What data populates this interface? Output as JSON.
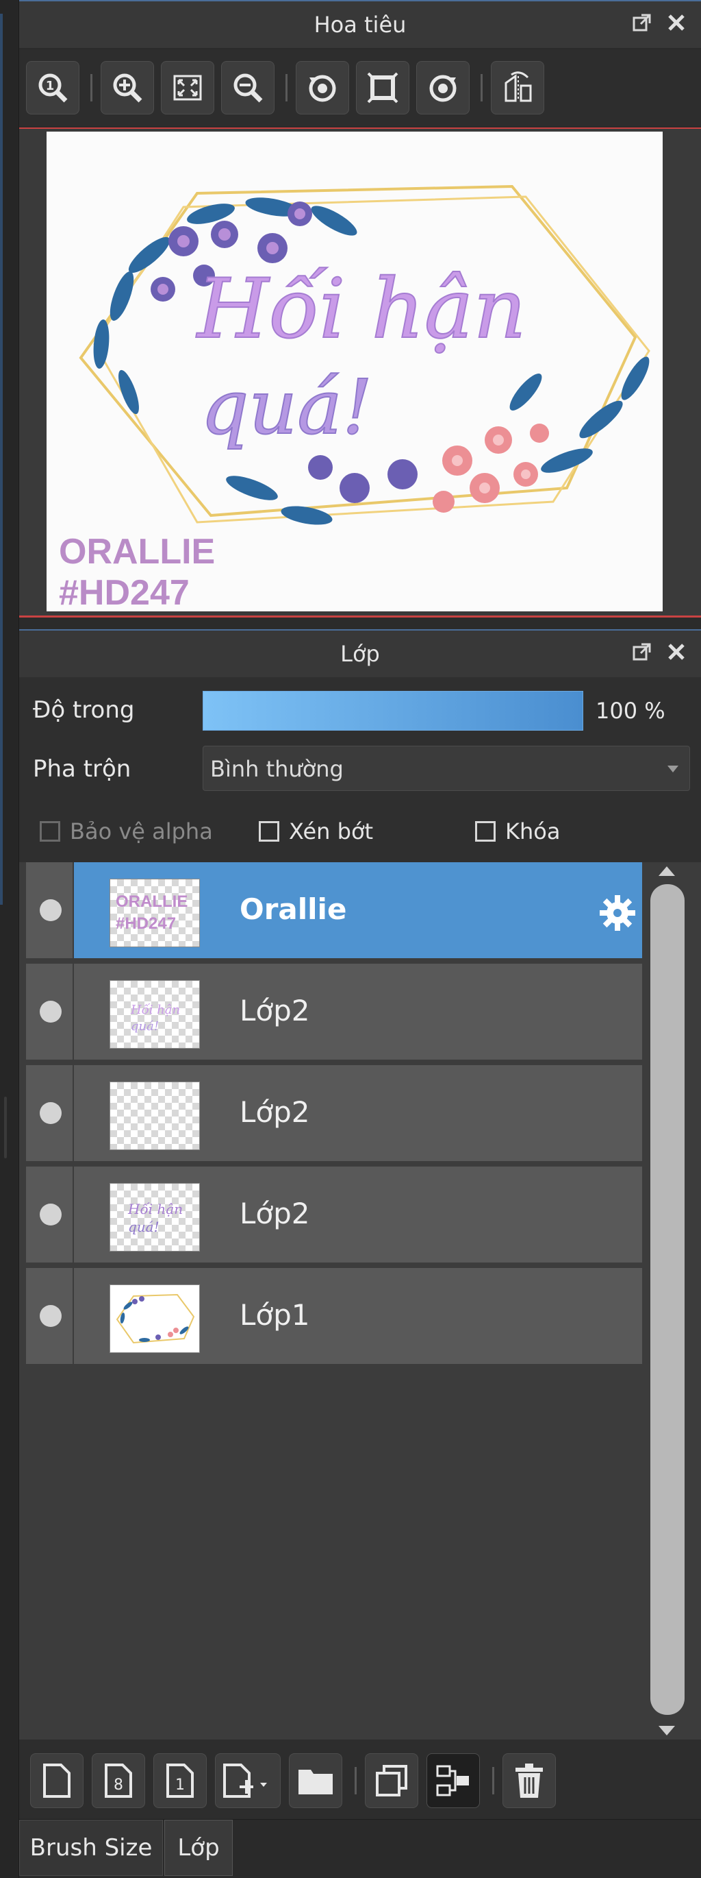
{
  "navigator": {
    "title": "Hoa tiêu",
    "tools": [
      "zoom-actual-icon",
      "zoom-in-icon",
      "fit-window-icon",
      "zoom-out-icon",
      "rotate-left-icon",
      "fit-canvas-icon",
      "rotate-right-icon",
      "flip-icon"
    ]
  },
  "preview": {
    "line1": "Hối hận",
    "line2": "quá!",
    "watermark1": "ORALLIE",
    "watermark2": "#HD247"
  },
  "layers_panel": {
    "title": "Lớp",
    "opacity_label": "Độ trong",
    "opacity_value": "100 %",
    "opacity_fraction": 1.0,
    "blend_label": "Pha trộn",
    "blend_value": "Bình thường",
    "protect_alpha": "Bảo vệ alpha",
    "clipping": "Xén bớt",
    "lock": "Khóa",
    "layers": [
      {
        "name": "Orallie",
        "selected": true,
        "thumb_text1": "ORALLIE",
        "thumb_text2": "#HD247"
      },
      {
        "name": "Lớp2",
        "selected": false,
        "thumb_text1": "Hối hận",
        "thumb_text2": "quá!"
      },
      {
        "name": "Lớp2",
        "selected": false,
        "thumb_text1": "",
        "thumb_text2": ""
      },
      {
        "name": "Lớp2",
        "selected": false,
        "thumb_text1": "Hối hận",
        "thumb_text2": "quá!"
      },
      {
        "name": "Lớp1",
        "selected": false,
        "thumb_text1": "",
        "thumb_text2": ""
      }
    ]
  },
  "bottom_tools": [
    "new-layer-icon",
    "new-8bit-layer-icon",
    "new-1bit-layer-icon",
    "add-layer-menu-icon",
    "new-folder-icon",
    "duplicate-layer-icon",
    "merge-down-icon",
    "delete-layer-icon"
  ],
  "tabs": {
    "brush_size": "Brush Size",
    "layer": "Lớp"
  },
  "colors": {
    "accent_blue": "#4f93d0",
    "panel_bg": "#2b2b2b",
    "row_bg": "#595959",
    "title_purple": "#c79be6"
  }
}
